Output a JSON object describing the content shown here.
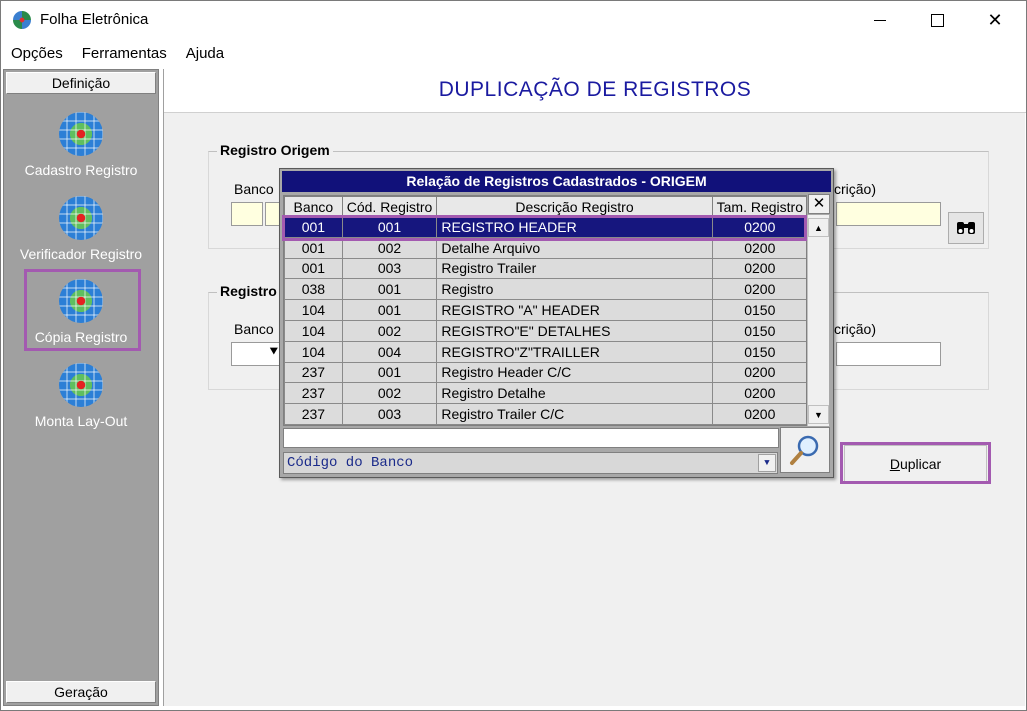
{
  "window": {
    "title": "Folha Eletrônica",
    "close_glyph": "✕"
  },
  "menu": [
    "Opções",
    "Ferramentas",
    "Ajuda"
  ],
  "sidebar": {
    "header": "Definição",
    "footer": "Geração",
    "items": [
      {
        "label": "Cadastro Registro",
        "icon": "globe-icon"
      },
      {
        "label": "Verificador Registro",
        "icon": "globe-icon"
      },
      {
        "label": "Cópia Registro",
        "icon": "globe-icon",
        "selected": true
      },
      {
        "label": "Monta Lay-Out",
        "icon": "globe-icon"
      }
    ]
  },
  "main": {
    "title": "DUPLICAÇÃO DE REGISTROS",
    "origin": {
      "legend": "Registro Origem",
      "banco_label": "Banco",
      "descricao_label": "crição)"
    },
    "dest": {
      "legend": "Registro",
      "banco_label": "Banco",
      "descricao_label": "crição)"
    },
    "duplicar_button_prefix": "D",
    "duplicar_button_rest": "uplicar",
    "dropdown_arrow": "⯆"
  },
  "popup": {
    "title": "Relação de Registros Cadastrados - ORIGEM",
    "close": "✕",
    "columns": [
      "Banco",
      "Cód. Registro",
      "Descrição Registro",
      "Tam. Registro"
    ],
    "rows": [
      [
        "001",
        "001",
        "REGISTRO HEADER",
        "0200"
      ],
      [
        "001",
        "002",
        "Detalhe Arquivo",
        "0200"
      ],
      [
        "001",
        "003",
        "Registro Trailer",
        "0200"
      ],
      [
        "038",
        "001",
        "Registro",
        "0200"
      ],
      [
        "104",
        "001",
        "REGISTRO \"A\" HEADER",
        "0150"
      ],
      [
        "104",
        "002",
        "REGISTRO\"E\" DETALHES",
        "0150"
      ],
      [
        "104",
        "004",
        "REGISTRO\"Z\"TRAILLER",
        "0150"
      ],
      [
        "237",
        "001",
        "Registro Header C/C",
        "0200"
      ],
      [
        "237",
        "002",
        "Registro Detalhe",
        "0200"
      ],
      [
        "237",
        "003",
        "Registro Trailer C/C",
        "0200"
      ]
    ],
    "selected_row": 0,
    "search_value": "",
    "search_field": "Código do Banco"
  },
  "colors": {
    "accent_outline": "#a35ab0",
    "title_blue": "#1a1aa0",
    "selected_row": "#16167e"
  }
}
